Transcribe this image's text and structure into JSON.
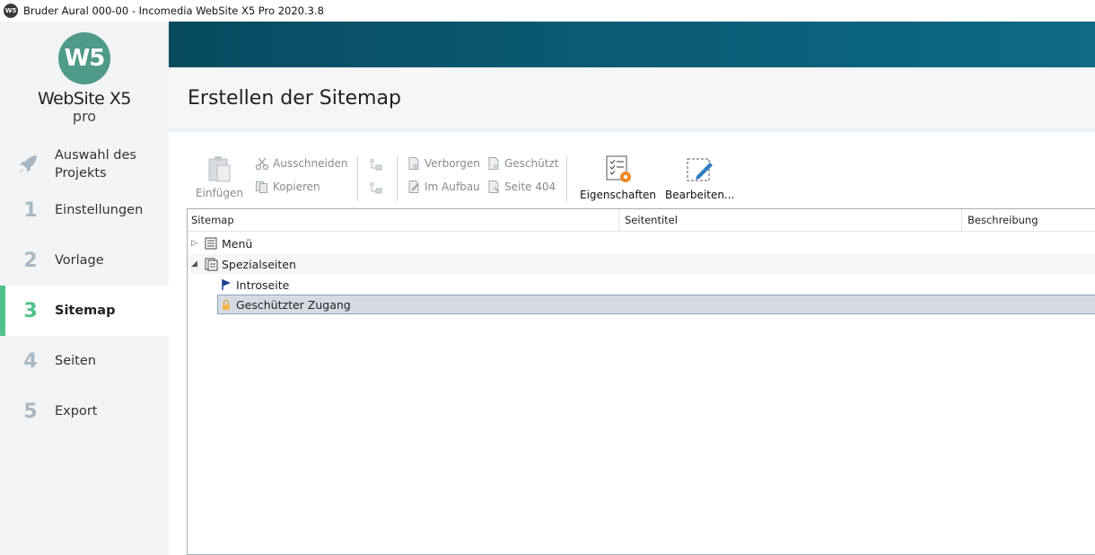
{
  "window": {
    "title": "Bruder Aural 000-00 - Incomedia WebSite X5 Pro 2020.3.8",
    "app_icon_text": "W5"
  },
  "logo": {
    "mark": "W5",
    "name": "WebSite X5",
    "edition": "pro"
  },
  "steps": [
    {
      "num": "",
      "label_line1": "Auswahl des",
      "label_line2": "Projekts"
    },
    {
      "num": "1",
      "label": "Einstellungen"
    },
    {
      "num": "2",
      "label": "Vorlage"
    },
    {
      "num": "3",
      "label": "Sitemap",
      "active": true
    },
    {
      "num": "4",
      "label": "Seiten"
    },
    {
      "num": "5",
      "label": "Export"
    }
  ],
  "page": {
    "title": "Erstellen der Sitemap"
  },
  "toolbar": {
    "paste": "Einfügen",
    "cut": "Ausschneiden",
    "copy": "Kopieren",
    "hidden": "Verborgen",
    "under_construction": "Im Aufbau",
    "protected": "Geschützt",
    "page404": "Seite 404",
    "properties": "Eigenschaften",
    "edit": "Bearbeiten..."
  },
  "tree": {
    "columns": [
      "Sitemap",
      "Seitentitel",
      "Beschreibung"
    ],
    "rows": [
      {
        "label": "Menü",
        "expanded": false
      },
      {
        "label": "Spezialseiten",
        "expanded": true
      },
      {
        "label": "Introseite"
      },
      {
        "label": "Geschützter Zugang",
        "selected": true
      }
    ]
  },
  "colors": {
    "accent": "#4fc18a",
    "banner": "#0b5c74",
    "logo": "#4f9a88",
    "selection": "#d6dbe3"
  }
}
